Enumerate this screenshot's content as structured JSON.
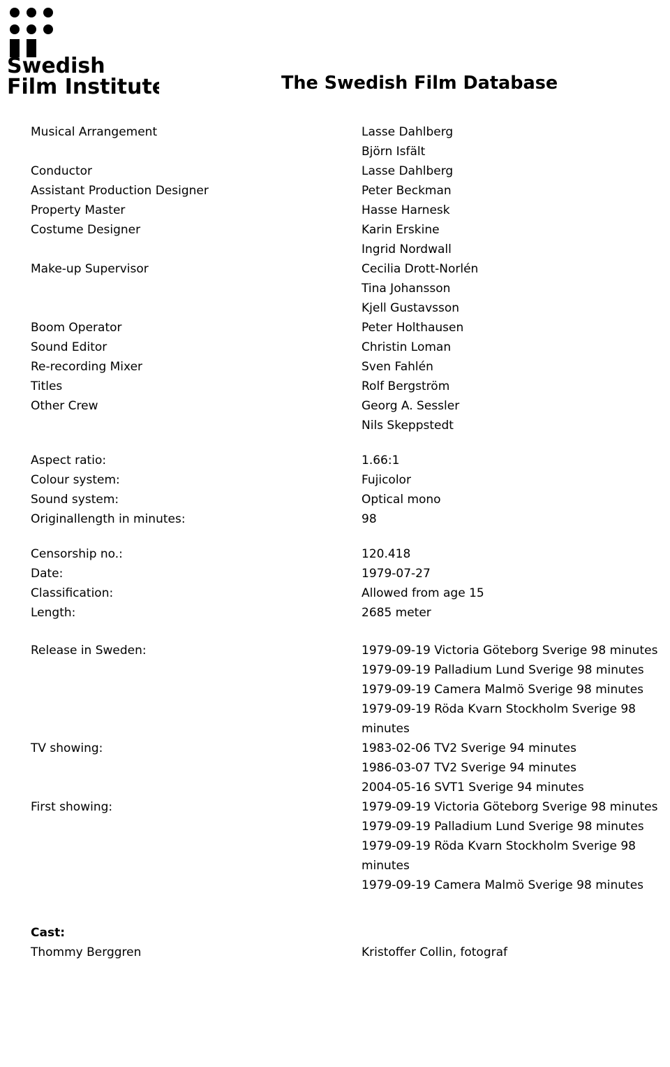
{
  "header": {
    "title": "The Swedish Film Database",
    "logo_text_line1": "Swedish",
    "logo_text_line2": "Film Institute",
    "logo_name": "swedish-film-institute-logo"
  },
  "credits": [
    {
      "label": "Musical Arrangement",
      "value": "Lasse Dahlberg"
    },
    {
      "label": "",
      "value": "Björn Isfält"
    },
    {
      "label": "Conductor",
      "value": "Lasse Dahlberg"
    },
    {
      "label": "Assistant Production Designer",
      "value": "Peter Beckman"
    },
    {
      "label": "Property Master",
      "value": "Hasse Harnesk"
    },
    {
      "label": "Costume Designer",
      "value": "Karin Erskine"
    },
    {
      "label": "",
      "value": "Ingrid Nordwall"
    },
    {
      "label": "Make-up Supervisor",
      "value": "Cecilia Drott-Norlén"
    },
    {
      "label": "",
      "value": "Tina Johansson"
    },
    {
      "label": "",
      "value": "Kjell Gustavsson"
    },
    {
      "label": "Boom Operator",
      "value": "Peter Holthausen"
    },
    {
      "label": "Sound Editor",
      "value": "Christin Loman"
    },
    {
      "label": "Re-recording Mixer",
      "value": "Sven Fahlén"
    },
    {
      "label": "Titles",
      "value": "Rolf Bergström"
    },
    {
      "label": "Other Crew",
      "value": "Georg A. Sessler"
    },
    {
      "label": "",
      "value": "Nils Skeppstedt"
    }
  ],
  "technical": [
    {
      "label": "Aspect ratio:",
      "value": "1.66:1"
    },
    {
      "label": "Colour system:",
      "value": "Fujicolor"
    },
    {
      "label": "Sound system:",
      "value": "Optical mono"
    },
    {
      "label": "Originallength in minutes:",
      "value": "98"
    }
  ],
  "censorship": [
    {
      "label": "Censorship no.:",
      "value": "120.418"
    },
    {
      "label": "Date:",
      "value": "1979-07-27"
    },
    {
      "label": "Classification:",
      "value": "Allowed from age 15"
    },
    {
      "label": "Length:",
      "value": "2685 meter"
    }
  ],
  "release": [
    {
      "label": "Release in Sweden:",
      "values": [
        "1979-09-19 Victoria Göteborg Sverige 98 minutes",
        "1979-09-19 Palladium Lund Sverige 98 minutes",
        "1979-09-19 Camera Malmö Sverige 98 minutes",
        "1979-09-19 Röda Kvarn Stockholm Sverige 98 minutes"
      ]
    },
    {
      "label": "TV showing:",
      "values": [
        "1983-02-06 TV2 Sverige 94 minutes",
        "1986-03-07 TV2 Sverige 94 minutes",
        "2004-05-16 SVT1 Sverige 94 minutes"
      ]
    },
    {
      "label": "First showing:",
      "values": [
        "1979-09-19 Victoria Göteborg Sverige 98 minutes",
        "1979-09-19 Palladium Lund Sverige 98 minutes",
        "1979-09-19 Röda Kvarn Stockholm Sverige 98 minutes",
        "1979-09-19 Camera Malmö Sverige 98 minutes"
      ]
    }
  ],
  "cast": {
    "heading": "Cast:",
    "rows": [
      {
        "name": "Thommy Berggren",
        "role": "Kristoffer Collin, fotograf"
      }
    ]
  }
}
